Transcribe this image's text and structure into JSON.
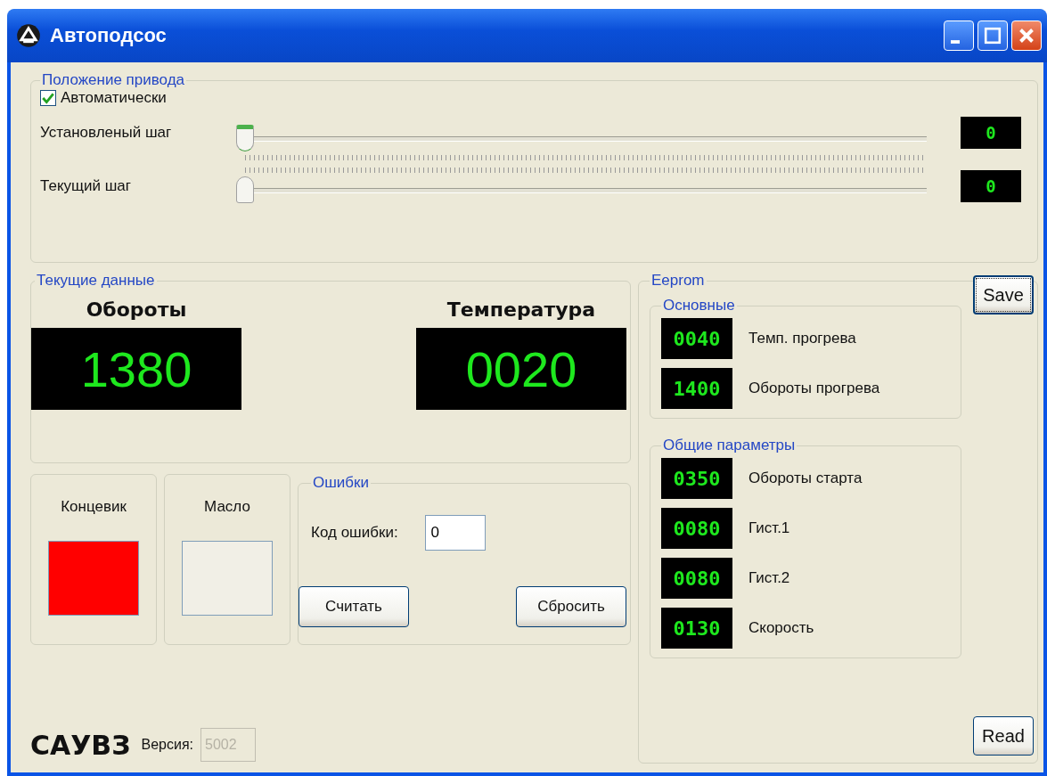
{
  "window": {
    "title": "Автоподсос"
  },
  "drive_position": {
    "title": "Положение привода",
    "auto": {
      "label": "Автоматически",
      "checked": true
    },
    "sliders": [
      {
        "kind": "set",
        "label": "Установленый шаг",
        "level": 0,
        "reading": "0"
      },
      {
        "kind": "current",
        "label": "Текущий шаг",
        "level": 0,
        "reading": "0"
      }
    ]
  },
  "current_data": {
    "title": "Текущие данные",
    "readouts": [
      {
        "label": "Обороты",
        "value": "1380"
      },
      {
        "label": "Температура",
        "value": "0020"
      }
    ]
  },
  "indicators": [
    {
      "label": "Концевик",
      "on": true
    },
    {
      "label": "Масло",
      "on": false
    }
  ],
  "errors": {
    "title": "Ошибки",
    "code_label": "Код ошибки:",
    "code_value": "0",
    "buttons": [
      "Считать",
      "Сбросить"
    ]
  },
  "eeprom": {
    "title": "Eeprom",
    "save": "Save",
    "read": "Read",
    "groups": [
      {
        "title": "Основные",
        "params": [
          {
            "value": "0040",
            "label": "Темп. прогрева"
          },
          {
            "value": "1400",
            "label": "Обороты прогрева"
          }
        ]
      },
      {
        "title": "Общие параметры",
        "params": [
          {
            "value": "0350",
            "label": "Обороты старта"
          },
          {
            "value": "0080",
            "label": "Гист.1"
          },
          {
            "value": "0080",
            "label": "Гист.2"
          },
          {
            "value": "0130",
            "label": "Скорость"
          }
        ]
      }
    ]
  },
  "footer": {
    "logo": "САУВЗ",
    "version_label": "Версия:",
    "version_value": "5002"
  }
}
